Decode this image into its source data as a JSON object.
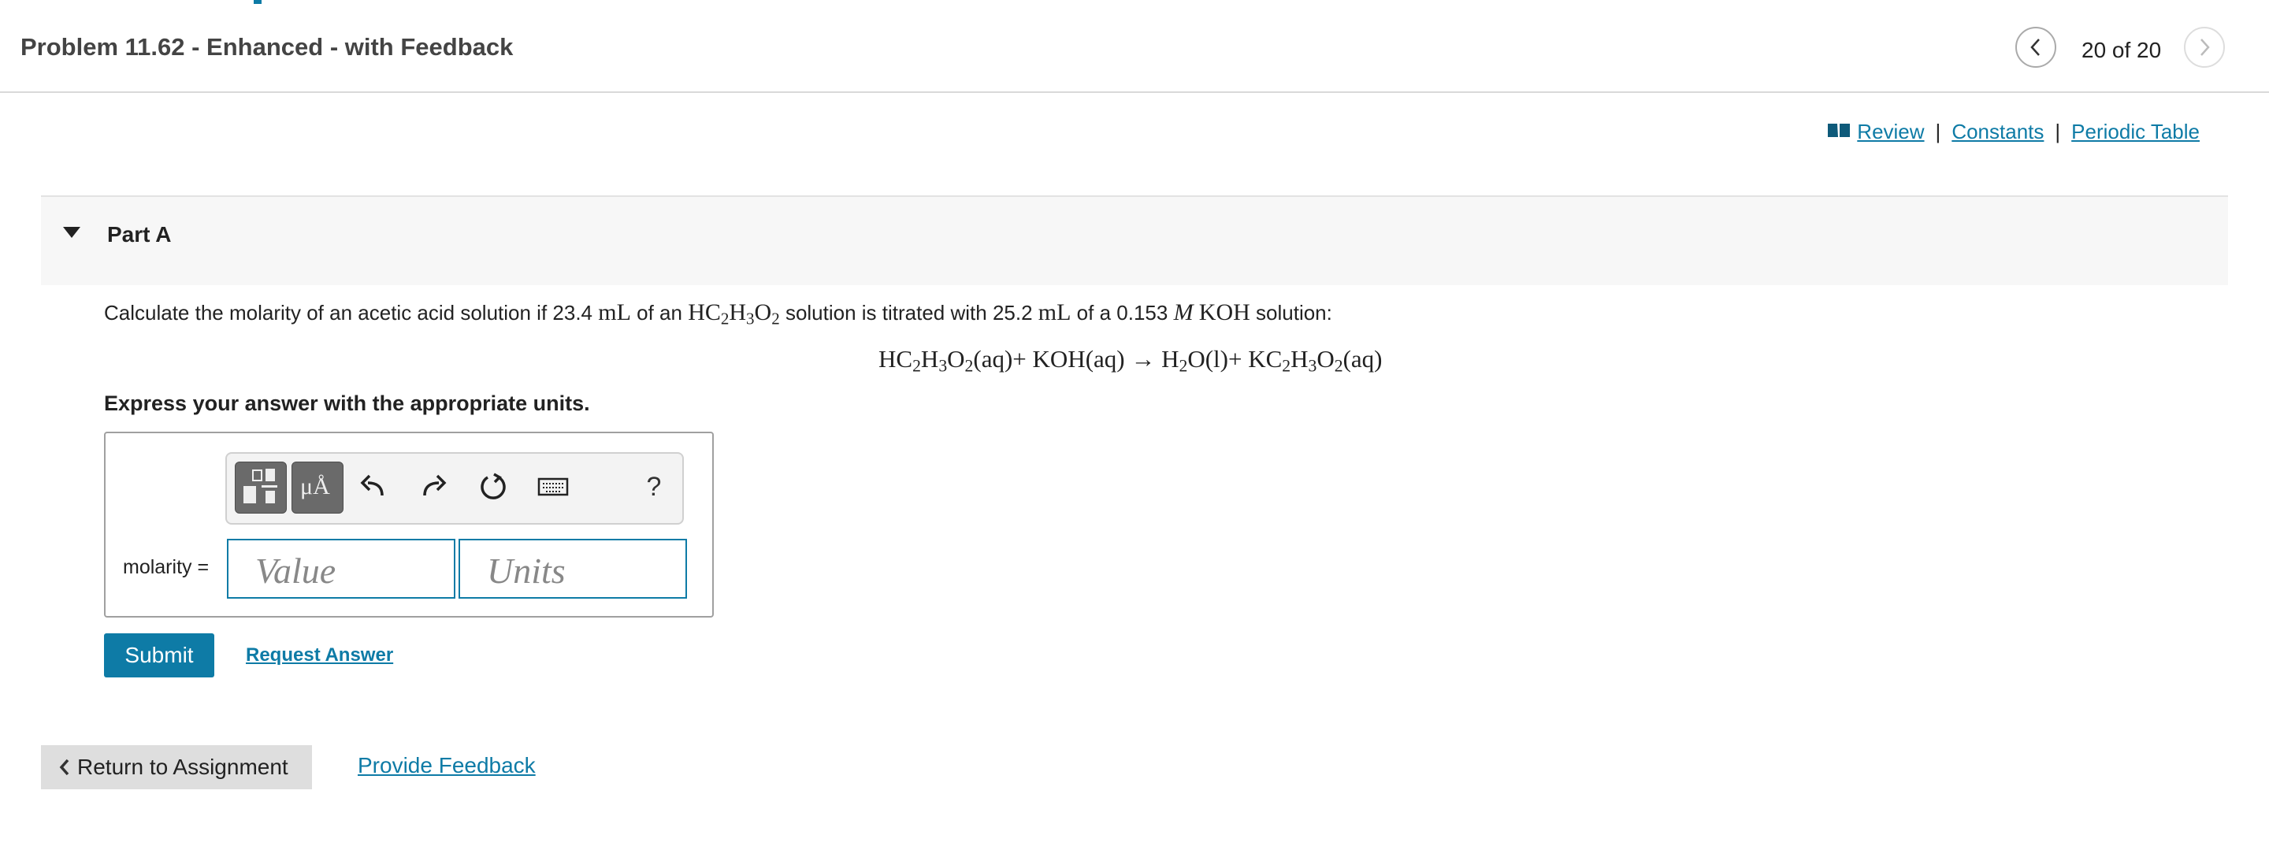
{
  "header": {
    "title": "Problem 11.62 - Enhanced - with Feedback",
    "position": "20 of 20",
    "prev_icon": "chevron-left-icon",
    "next_icon": "chevron-right-icon"
  },
  "resources": {
    "icon": "book-icon",
    "review": "Review",
    "separator": "|",
    "constants": "Constants",
    "periodic_table": "Periodic Table"
  },
  "part": {
    "label": "Part A",
    "question_intro": "Calculate the molarity of an acetic acid solution if 23.4 ",
    "question_unit1": "mL",
    "question_mid1": " of an ",
    "question_mid2": " solution is titrated with 25.2 ",
    "question_unit2": "mL",
    "question_mid3": " of a 0.153 ",
    "question_M": "M",
    "question_KOH": "KOH",
    "question_end": " solution:",
    "instruction": "Express your answer with the appropriate units."
  },
  "answer": {
    "label": "molarity =",
    "value_placeholder": "Value",
    "units_placeholder": "Units",
    "toolbar": {
      "templates_icon": "templates-icon",
      "units_symbol": "μÅ",
      "undo_icon": "undo-icon",
      "redo_icon": "redo-icon",
      "reset_icon": "reset-icon",
      "keyboard_icon": "keyboard-icon",
      "help": "?"
    }
  },
  "actions": {
    "submit": "Submit",
    "request_answer": "Request Answer",
    "return": "Return to Assignment",
    "feedback": "Provide Feedback"
  },
  "colors": {
    "accent": "#0e7ba6",
    "text": "#212121",
    "part_bg": "#f7f7f7",
    "return_bg": "#dedede"
  }
}
